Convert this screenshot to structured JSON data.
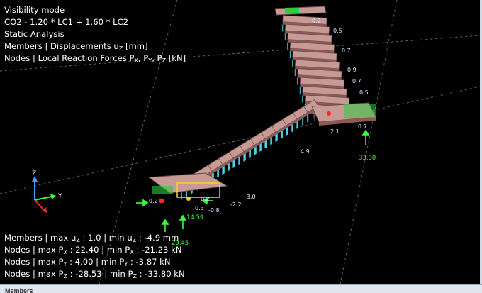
{
  "overlay": {
    "mode": "Visibility mode",
    "combo": "CO2 - 1.20 * LC1 + 1.60 * LC2",
    "analysis": "Static Analysis",
    "members_pre": "Members | Displacements u",
    "members_sub": "Z",
    "members_unit": " [mm]",
    "nodes_pre": "Nodes | Local Reaction Forces P",
    "nodes_sub_x": "X",
    "nodes_sep1": ", P",
    "nodes_sub_y": "Y",
    "nodes_sep2": ", P",
    "nodes_sub_z": "Z",
    "nodes_unit": " [kN]"
  },
  "results": {
    "uz_pre": "Members | max u",
    "uz_sub": "Z",
    "uz_mid": " : 1.0 | min u",
    "uz_sub2": "Z",
    "uz_end": " : -4.9 mm",
    "px_pre": "Nodes | max P",
    "px_sub": "X",
    "px_mid": " : 22.40 | min P",
    "px_sub2": "X",
    "px_end": " : -21.23 kN",
    "py_pre": "Nodes | max P",
    "py_sub": "Y",
    "py_mid": " : 4.00 | min P",
    "py_sub2": "Y",
    "py_end": " : -3.87 kN",
    "pz_pre": "Nodes | max P",
    "pz_sub": "Z",
    "pz_mid": " : -28.53 | min P",
    "pz_sub2": "Z",
    "pz_end": " : -33.80 kN"
  },
  "axes": {
    "z": "Z",
    "y": "Y"
  },
  "value_labels": {
    "v1": "0.2",
    "v2": "0.5",
    "v3": "0.7",
    "v4": "0.9",
    "v5": "0.7",
    "v6": "0.5",
    "v7": "2.1",
    "v8": "0.7",
    "v9": "4.9",
    "v10": "-3.0",
    "v11": "-2.2",
    "v12": "0.3",
    "v13": "-0.8",
    "v14": "-0.2",
    "v15": "0.2"
  },
  "reactions": {
    "r1": "33.80",
    "r2": "14.59",
    "r3": "29.45"
  },
  "bottom_panel": {
    "title": "Members"
  },
  "colors": {
    "background": "#000000",
    "tread": "#c79a95",
    "load": "#4ad6e8",
    "reaction": "#39ff39",
    "support": "#ff2a2a",
    "grid": "#6a6a6a"
  }
}
